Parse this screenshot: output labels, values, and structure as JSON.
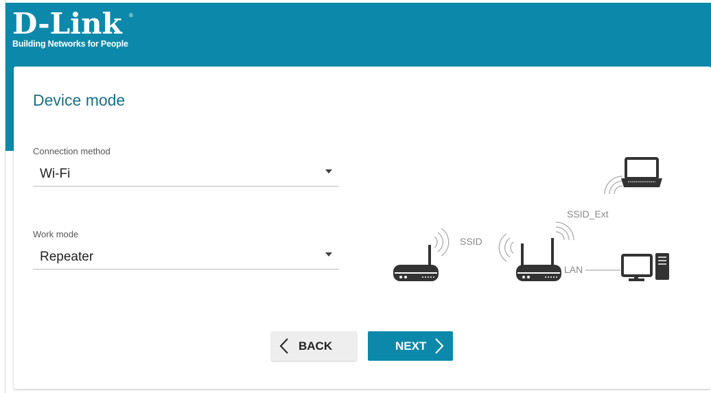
{
  "brand": {
    "name": "D-Link",
    "registered": "®",
    "tagline": "Building Networks for People"
  },
  "page": {
    "title": "Device mode"
  },
  "form": {
    "connection_method": {
      "label": "Connection method",
      "value": "Wi-Fi"
    },
    "work_mode": {
      "label": "Work mode",
      "value": "Repeater"
    }
  },
  "diagram": {
    "ssid": "SSID",
    "ssid_ext": "SSID_Ext",
    "lan": "LAN"
  },
  "buttons": {
    "back": "BACK",
    "next": "NEXT"
  },
  "colors": {
    "brand_teal": "#0c89aa",
    "title_teal": "#1c6e86",
    "icon_dark": "#333333"
  }
}
